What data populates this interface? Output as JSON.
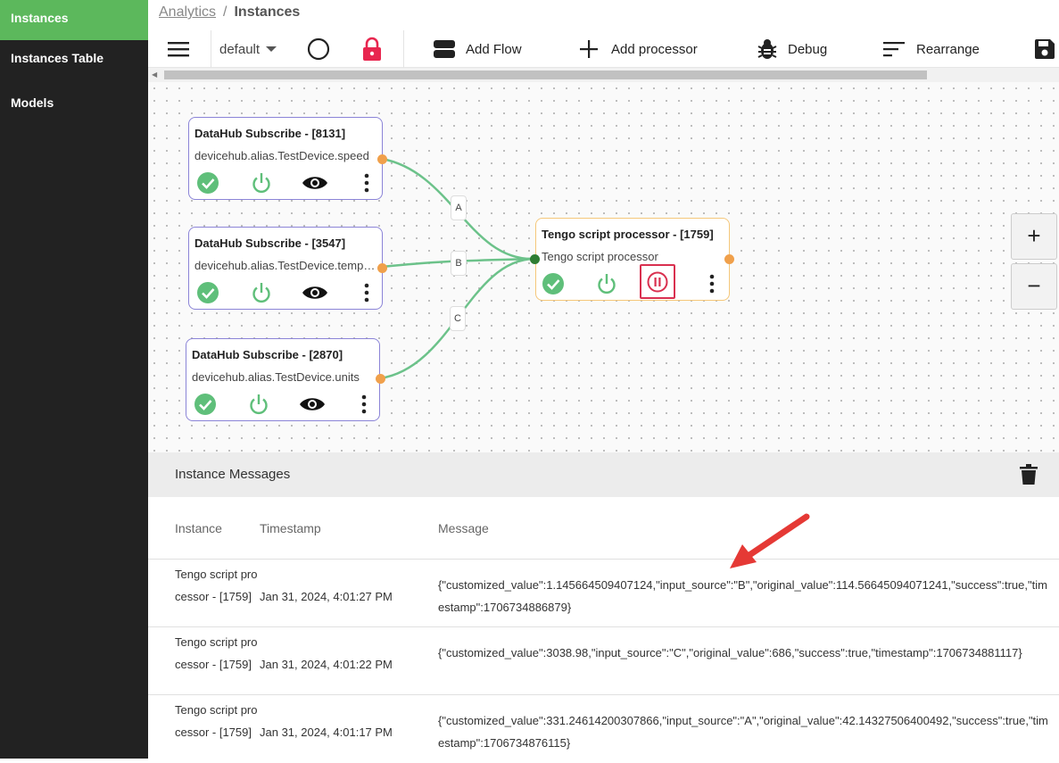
{
  "sidebar": {
    "items": [
      {
        "label": "Instances"
      },
      {
        "label": "Instances Table"
      },
      {
        "label": "Models"
      }
    ]
  },
  "breadcrumb": {
    "parent": "Analytics",
    "separator": "/",
    "current": "Instances"
  },
  "toolbar": {
    "menu_icon": "hamburger-menu-icon",
    "flow_select": "default",
    "add_flow_label": "Add Flow",
    "add_processor_label": "Add processor",
    "debug_label": "Debug",
    "rearrange_label": "Rearrange",
    "save_icon": "floppy-disk-icon"
  },
  "nodes": [
    {
      "title": "DataHub Subscribe - [8131]",
      "subtitle": "devicehub.alias.TestDevice.speed"
    },
    {
      "title": "DataHub Subscribe - [3547]",
      "subtitle": "devicehub.alias.TestDevice.temperature"
    },
    {
      "title": "DataHub Subscribe - [2870]",
      "subtitle": "devicehub.alias.TestDevice.units"
    },
    {
      "title": "Tengo script processor - [1759]",
      "subtitle": "Tengo script processor"
    }
  ],
  "wire_labels": [
    "A",
    "B",
    "C"
  ],
  "zoom": {
    "in": "+",
    "out": "−"
  },
  "messages_panel": {
    "title": "Instance Messages",
    "columns": [
      "Instance",
      "Timestamp",
      "Message"
    ],
    "rows": [
      {
        "instance": "Tengo script processor - [1759]",
        "timestamp": "Jan 31, 2024, 4:01:27 PM",
        "message": "{\"customized_value\":1.145664509407124,\"input_source\":\"B\",\"original_value\":114.56645094071241,\"success\":true,\"timestamp\":1706734886879}"
      },
      {
        "instance": "Tengo script processor - [1759]",
        "timestamp": "Jan 31, 2024, 4:01:22 PM",
        "message": "{\"customized_value\":3038.98,\"input_source\":\"C\",\"original_value\":686,\"success\":true,\"timestamp\":1706734881117}"
      },
      {
        "instance": "Tengo script processor - [1759]",
        "timestamp": "Jan 31, 2024, 4:01:17 PM",
        "message": "{\"customized_value\":331.24614200307866,\"input_source\":\"A\",\"original_value\":42.14327506400492,\"success\":true,\"timestamp\":1706734876115}"
      }
    ]
  },
  "colors": {
    "accent": "#5cb85c",
    "sidebar": "#222222",
    "node_border": "#8b84d7",
    "processor_border": "#f5c77a",
    "pause": "#d9304f",
    "arrow": "#e53935"
  }
}
